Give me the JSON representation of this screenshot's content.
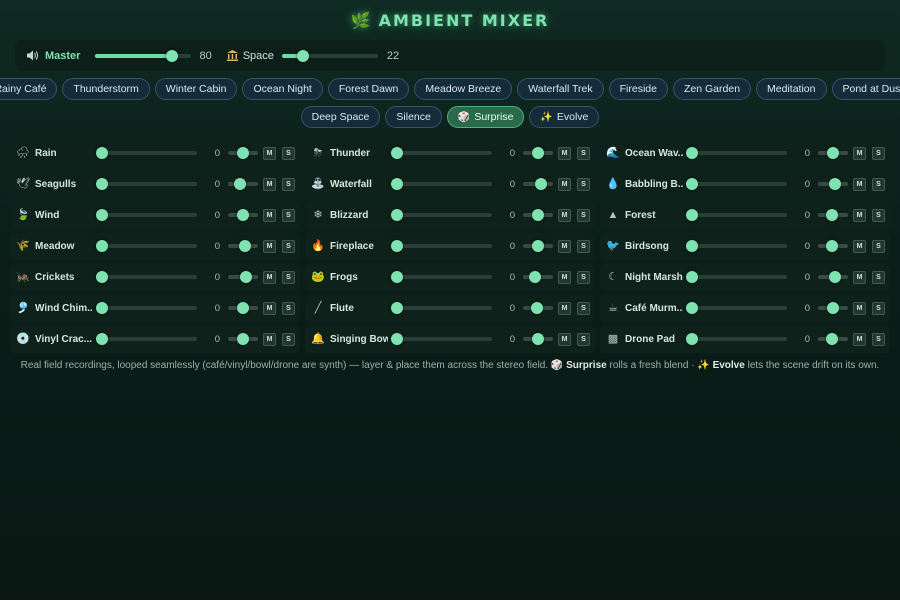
{
  "title": {
    "icon": "🌿",
    "text": "AMBIENT MIXER"
  },
  "master": {
    "label": "Master",
    "value": "80",
    "level": 0.8,
    "icon": "speaker-icon"
  },
  "space": {
    "label": "Space",
    "value": "22",
    "level": 0.22,
    "icon": "building-icon"
  },
  "presets_row1": [
    "Rainy Café",
    "Thunderstorm",
    "Winter Cabin",
    "Ocean Night",
    "Forest Dawn",
    "Meadow Breeze",
    "Waterfall Trek",
    "Fireside",
    "Zen Garden",
    "Meditation",
    "Pond at Dusk"
  ],
  "presets_row2": [
    {
      "label": "Deep Space",
      "icon": "",
      "active": false
    },
    {
      "label": "Silence",
      "icon": "",
      "active": false
    },
    {
      "label": "Surprise",
      "icon": "🎲",
      "active": true
    },
    {
      "label": "Evolve",
      "icon": "✨",
      "active": false
    }
  ],
  "mute_label": "M",
  "solo_label": "S",
  "channels": [
    {
      "name": "Rain",
      "icon": "🌧",
      "value": "0",
      "pan": 0.5
    },
    {
      "name": "Thunder",
      "icon": "⛈",
      "value": "0",
      "pan": 0.5
    },
    {
      "name": "Ocean Wav...",
      "icon": "🌊",
      "value": "0",
      "pan": 0.5
    },
    {
      "name": "Seagulls",
      "icon": "🕊",
      "value": "0",
      "pan": 0.4
    },
    {
      "name": "Waterfall",
      "icon": "⛲",
      "value": "0",
      "pan": 0.6
    },
    {
      "name": "Babbling B...",
      "icon": "💧",
      "value": "0",
      "pan": 0.55
    },
    {
      "name": "Wind",
      "icon": "🍃",
      "value": "0",
      "pan": 0.5
    },
    {
      "name": "Blizzard",
      "icon": "❄",
      "value": "0",
      "pan": 0.5
    },
    {
      "name": "Forest",
      "icon": "▲",
      "value": "0",
      "pan": 0.45
    },
    {
      "name": "Meadow",
      "icon": "🌾",
      "value": "0",
      "pan": 0.55
    },
    {
      "name": "Fireplace",
      "icon": "🔥",
      "value": "0",
      "pan": 0.5
    },
    {
      "name": "Birdsong",
      "icon": "🐦",
      "value": "0",
      "pan": 0.45
    },
    {
      "name": "Crickets",
      "icon": "🦗",
      "value": "0",
      "pan": 0.6
    },
    {
      "name": "Frogs",
      "icon": "🐸",
      "value": "0",
      "pan": 0.4
    },
    {
      "name": "Night Marsh",
      "icon": "☾",
      "value": "0",
      "pan": 0.55
    },
    {
      "name": "Wind Chim...",
      "icon": "🎐",
      "value": "0",
      "pan": 0.5
    },
    {
      "name": "Flute",
      "icon": "╱",
      "value": "0",
      "pan": 0.45
    },
    {
      "name": "Café Murm...",
      "icon": "☕",
      "value": "0",
      "pan": 0.5
    },
    {
      "name": "Vinyl Crac...",
      "icon": "💿",
      "value": "0",
      "pan": 0.5
    },
    {
      "name": "Singing Bowl",
      "icon": "🔔",
      "value": "0",
      "pan": 0.5
    },
    {
      "name": "Drone Pad",
      "icon": "▩",
      "value": "0",
      "pan": 0.45
    }
  ],
  "footnote": {
    "part1": "Real field recordings, looped seamlessly (café/vinyl/bowl/drone are synth) — layer & place them across the stereo field. ",
    "surprise_icon": "🎲",
    "surprise": "Surprise",
    "part2": " rolls a fresh blend · ",
    "evolve_icon": "✨",
    "evolve": "Evolve",
    "part3": " lets the scene drift on its own."
  }
}
